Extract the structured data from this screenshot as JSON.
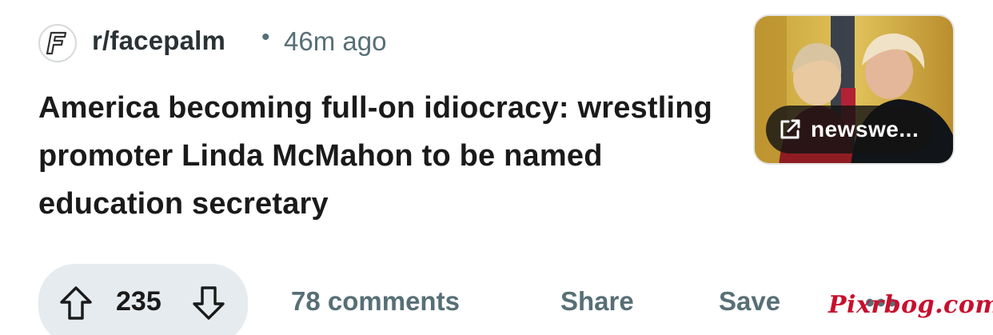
{
  "post": {
    "subreddit": "r/facepalm",
    "separator": "•",
    "time": "46m ago",
    "title": "America becoming full-on idiocracy: wrestling promoter Linda McMahon to be named education secretary",
    "thumbnail": {
      "link_label": "newswe..."
    }
  },
  "actions": {
    "score": "235",
    "comments_label": "78 comments",
    "share_label": "Share",
    "save_label": "Save",
    "more_label": "•••"
  },
  "watermark": "Pixrbog.com",
  "icons": {
    "subreddit_avatar": "facepalm-f-logo-icon",
    "external_link": "external-link-icon",
    "upvote": "upvote-arrow-icon",
    "downvote": "downvote-arrow-icon"
  },
  "colors": {
    "text_primary": "#1a1a1b",
    "text_secondary": "#576f76",
    "vote_pill_bg": "#e5ebee",
    "watermark": "#c8102e"
  }
}
